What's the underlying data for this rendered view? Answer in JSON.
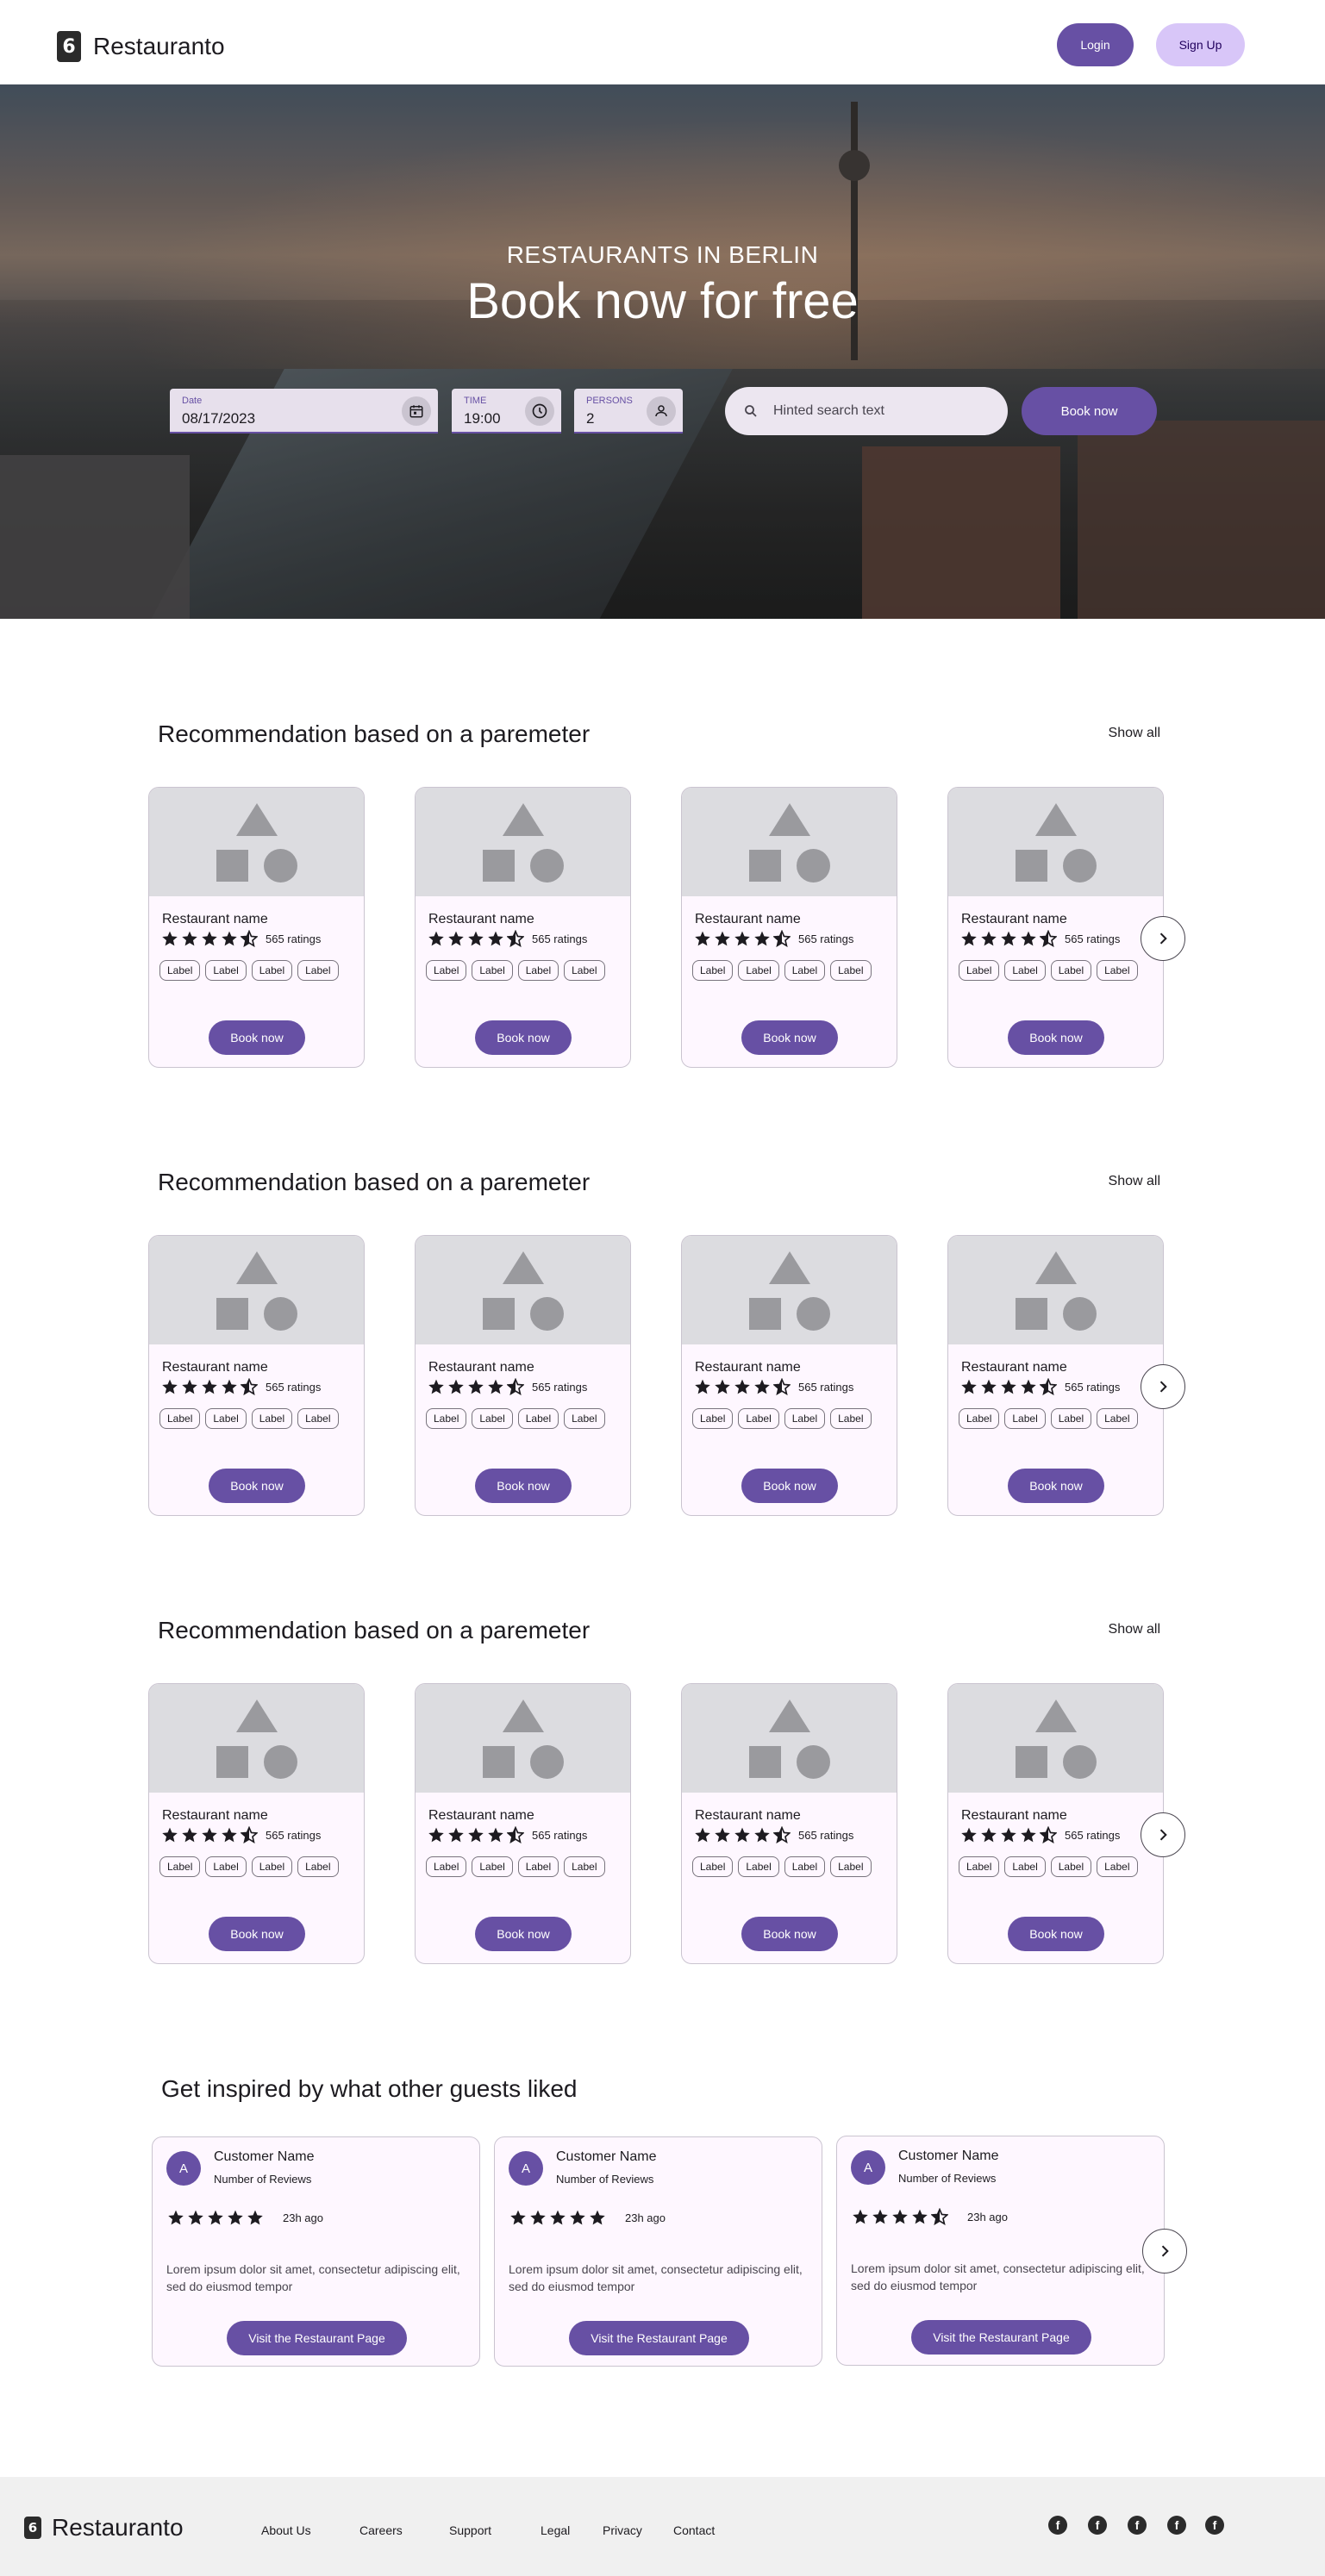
{
  "header": {
    "logo_mark": "6",
    "brand": "Restauranto",
    "login_label": "Login",
    "signup_label": "Sign Up"
  },
  "hero": {
    "subtitle": "RESTAURANTS IN BERLIN",
    "title": "Book now for free",
    "date": {
      "label": "Date",
      "value": "08/17/2023"
    },
    "time": {
      "label": "TIME",
      "value": "19:00"
    },
    "persons": {
      "label": "PERSONS",
      "value": "2"
    },
    "search_placeholder": "Hinted search text",
    "book_label": "Book now"
  },
  "sections": [
    {
      "title": "Recommendation based on a paremeter",
      "show_all": "Show all"
    },
    {
      "title": "Recommendation based on a paremeter",
      "show_all": "Show all"
    },
    {
      "title": "Recommendation based on a paremeter",
      "show_all": "Show all"
    }
  ],
  "restaurant_card": {
    "name": "Restaurant name",
    "rating": 4.5,
    "ratings_text": "565 ratings",
    "chips": [
      "Label",
      "Label",
      "Label",
      "Label"
    ],
    "button": "Book now"
  },
  "reviews": {
    "title": "Get inspired by what other guests liked",
    "items": [
      {
        "avatar": "A",
        "name": "Customer Name",
        "reviews": "Number of Reviews",
        "rating": 5,
        "ago": "23h ago",
        "text": "Lorem ipsum dolor sit amet, consectetur adipiscing elit, sed do eiusmod tempor",
        "button": "Visit the Restaurant Page"
      },
      {
        "avatar": "A",
        "name": "Customer Name",
        "reviews": "Number of Reviews",
        "rating": 5,
        "ago": "23h ago",
        "text": "Lorem ipsum dolor sit amet, consectetur adipiscing elit, sed do eiusmod tempor",
        "button": "Visit the Restaurant Page"
      },
      {
        "avatar": "A",
        "name": "Customer Name",
        "reviews": "Number of Reviews",
        "rating": 4.5,
        "ago": "23h ago",
        "text": "Lorem ipsum dolor sit amet, consectetur adipiscing elit, sed do eiusmod tempor",
        "button": "Visit the Restaurant Page"
      }
    ]
  },
  "footer": {
    "logo_mark": "6",
    "brand": "Restauranto",
    "links": [
      "About Us",
      "Careers",
      "Support",
      "Legal",
      "Privacy",
      "Contact"
    ],
    "social_icons": [
      "facebook-icon",
      "facebook-icon",
      "facebook-icon",
      "facebook-icon",
      "facebook-icon"
    ]
  },
  "colors": {
    "primary": "#6750a4",
    "secondary_container": "#d8c6f8",
    "card_surface": "#fef7ff",
    "footer_bg": "#f0f0f0"
  }
}
